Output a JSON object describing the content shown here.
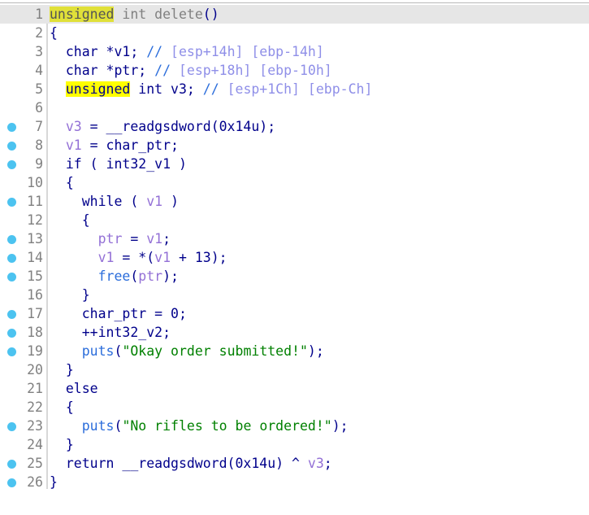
{
  "view": {
    "title": "Decompiler pseudocode",
    "colors": {
      "background": "#ffffff",
      "current_line_bg": "#e6e6e6",
      "highlight": "#ffff00",
      "breakpoint_dot": "#4cc3f0",
      "line_number": "#808080",
      "keyword": "#00008b",
      "local_var": "#9370d6",
      "function": "#2b6ddb",
      "comment": "#8f8fe8",
      "string": "#008000",
      "gutter_rule": "#d8d8d8"
    },
    "gutter": {
      "breakpoint_lines": [
        7,
        8,
        9,
        11,
        13,
        14,
        15,
        17,
        18,
        19,
        23,
        25,
        26
      ],
      "dot_icon": "breakpoint-dot-icon"
    },
    "current_line": 1,
    "search_term": "unsigned"
  },
  "code": {
    "lines": [
      {
        "n": "1",
        "current": true,
        "tokens": [
          {
            "t": "unsigned",
            "c": "t-gray",
            "hl": "dim"
          },
          {
            "t": " int delete",
            "c": "t-gray"
          },
          {
            "t": "()",
            "c": "t-plain"
          }
        ]
      },
      {
        "n": "2",
        "tokens": [
          {
            "t": "{",
            "c": "t-plain"
          }
        ]
      },
      {
        "n": "3",
        "tokens": [
          {
            "t": "  char *v1; ",
            "c": "t-plain"
          },
          {
            "t": "//",
            "c": "t-cmt"
          },
          {
            "t": " [esp+14h] [ebp-14h]",
            "c": "t-cmttxt"
          }
        ]
      },
      {
        "n": "4",
        "tokens": [
          {
            "t": "  char *ptr; ",
            "c": "t-plain"
          },
          {
            "t": "//",
            "c": "t-cmt"
          },
          {
            "t": " [esp+18h] [ebp-10h]",
            "c": "t-cmttxt"
          }
        ]
      },
      {
        "n": "5",
        "tokens": [
          {
            "t": "  ",
            "c": "t-plain"
          },
          {
            "t": "unsigned",
            "c": "t-plain",
            "hl": "yellow"
          },
          {
            "t": " int v3; ",
            "c": "t-plain"
          },
          {
            "t": "//",
            "c": "t-cmt"
          },
          {
            "t": " [esp+1Ch] [ebp-Ch]",
            "c": "t-cmttxt"
          }
        ]
      },
      {
        "n": "6",
        "tokens": []
      },
      {
        "n": "7",
        "tokens": [
          {
            "t": "  ",
            "c": "t-plain"
          },
          {
            "t": "v3",
            "c": "t-local"
          },
          {
            "t": " = __readgsdword(0x14u);",
            "c": "t-plain"
          }
        ]
      },
      {
        "n": "8",
        "tokens": [
          {
            "t": "  ",
            "c": "t-plain"
          },
          {
            "t": "v1",
            "c": "t-local"
          },
          {
            "t": " = char_ptr;",
            "c": "t-plain"
          }
        ]
      },
      {
        "n": "9",
        "tokens": [
          {
            "t": "  if ( int32_v1 )",
            "c": "t-plain"
          }
        ]
      },
      {
        "n": "10",
        "tokens": [
          {
            "t": "  {",
            "c": "t-plain"
          }
        ]
      },
      {
        "n": "11",
        "tokens": [
          {
            "t": "    while ( ",
            "c": "t-plain"
          },
          {
            "t": "v1",
            "c": "t-local"
          },
          {
            "t": " )",
            "c": "t-plain"
          }
        ]
      },
      {
        "n": "12",
        "tokens": [
          {
            "t": "    {",
            "c": "t-plain"
          }
        ]
      },
      {
        "n": "13",
        "tokens": [
          {
            "t": "      ",
            "c": "t-plain"
          },
          {
            "t": "ptr",
            "c": "t-local"
          },
          {
            "t": " = ",
            "c": "t-plain"
          },
          {
            "t": "v1",
            "c": "t-local"
          },
          {
            "t": ";",
            "c": "t-plain"
          }
        ]
      },
      {
        "n": "14",
        "tokens": [
          {
            "t": "      ",
            "c": "t-plain"
          },
          {
            "t": "v1",
            "c": "t-local"
          },
          {
            "t": " = *(",
            "c": "t-plain"
          },
          {
            "t": "v1",
            "c": "t-local"
          },
          {
            "t": " + 13);",
            "c": "t-plain"
          }
        ]
      },
      {
        "n": "15",
        "tokens": [
          {
            "t": "      ",
            "c": "t-plain"
          },
          {
            "t": "free",
            "c": "t-func"
          },
          {
            "t": "(",
            "c": "t-plain"
          },
          {
            "t": "ptr",
            "c": "t-local"
          },
          {
            "t": ");",
            "c": "t-plain"
          }
        ]
      },
      {
        "n": "16",
        "tokens": [
          {
            "t": "    }",
            "c": "t-plain"
          }
        ]
      },
      {
        "n": "17",
        "tokens": [
          {
            "t": "    char_ptr = 0;",
            "c": "t-plain"
          }
        ]
      },
      {
        "n": "18",
        "tokens": [
          {
            "t": "    ++int32_v2;",
            "c": "t-plain"
          }
        ]
      },
      {
        "n": "19",
        "tokens": [
          {
            "t": "    ",
            "c": "t-plain"
          },
          {
            "t": "puts",
            "c": "t-func"
          },
          {
            "t": "(",
            "c": "t-plain"
          },
          {
            "t": "\"Okay order submitted!\"",
            "c": "t-str"
          },
          {
            "t": ");",
            "c": "t-plain"
          }
        ]
      },
      {
        "n": "20",
        "tokens": [
          {
            "t": "  }",
            "c": "t-plain"
          }
        ]
      },
      {
        "n": "21",
        "tokens": [
          {
            "t": "  else",
            "c": "t-plain"
          }
        ]
      },
      {
        "n": "22",
        "tokens": [
          {
            "t": "  {",
            "c": "t-plain"
          }
        ]
      },
      {
        "n": "23",
        "tokens": [
          {
            "t": "    ",
            "c": "t-plain"
          },
          {
            "t": "puts",
            "c": "t-func"
          },
          {
            "t": "(",
            "c": "t-plain"
          },
          {
            "t": "\"No rifles to be ordered!\"",
            "c": "t-str"
          },
          {
            "t": ");",
            "c": "t-plain"
          }
        ]
      },
      {
        "n": "24",
        "tokens": [
          {
            "t": "  }",
            "c": "t-plain"
          }
        ]
      },
      {
        "n": "25",
        "tokens": [
          {
            "t": "  return __readgsdword(0x14u) ^ ",
            "c": "t-plain"
          },
          {
            "t": "v3",
            "c": "t-local"
          },
          {
            "t": ";",
            "c": "t-plain"
          }
        ]
      },
      {
        "n": "26",
        "tokens": [
          {
            "t": "}",
            "c": "t-plain"
          }
        ]
      }
    ]
  }
}
